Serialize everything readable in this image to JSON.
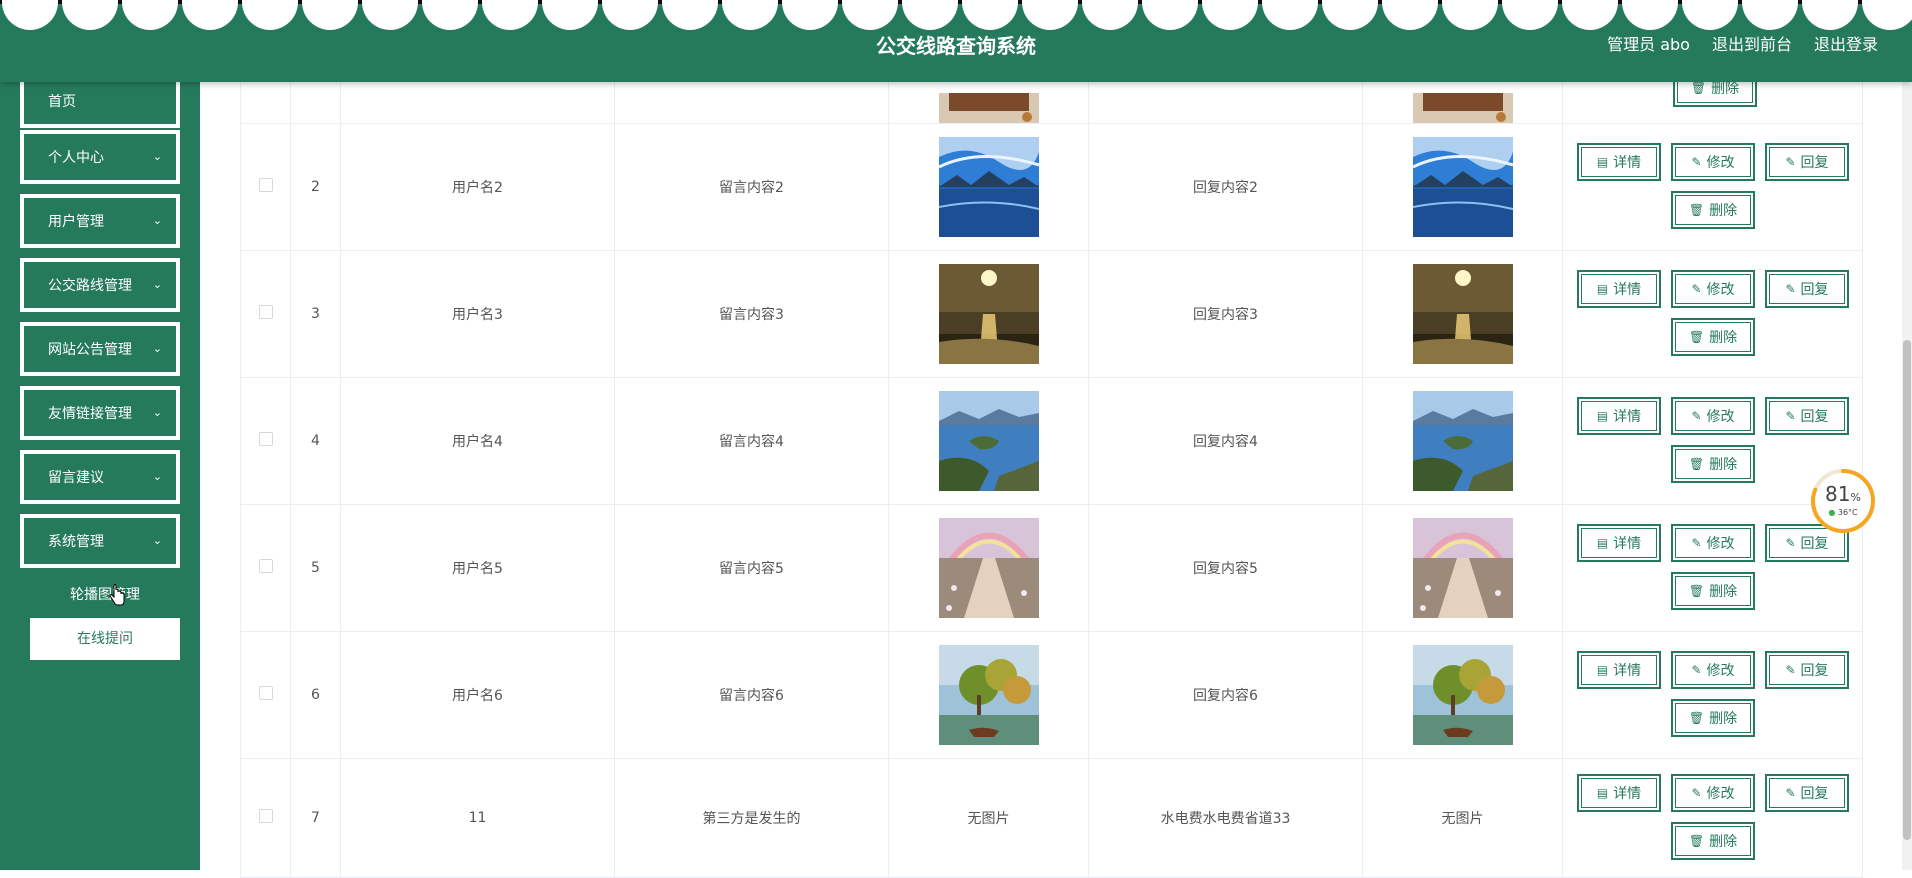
{
  "header": {
    "title": "公交线路查询系统",
    "user_label": "管理员 abo",
    "back_label": "退出到前台",
    "logout_label": "退出登录"
  },
  "sidebar": {
    "items": [
      {
        "label": "首页",
        "has_arrow": false
      },
      {
        "label": "个人中心",
        "has_arrow": true
      },
      {
        "label": "用户管理",
        "has_arrow": true
      },
      {
        "label": "公交路线管理",
        "has_arrow": true
      },
      {
        "label": "网站公告管理",
        "has_arrow": true
      },
      {
        "label": "友情链接管理",
        "has_arrow": true
      },
      {
        "label": "留言建议",
        "has_arrow": true
      },
      {
        "label": "系统管理",
        "has_arrow": true
      }
    ],
    "submenu": [
      {
        "label": "轮播图管理",
        "active": true
      },
      {
        "label": "在线提问",
        "active": false
      }
    ]
  },
  "table": {
    "rows": [
      {
        "index": "2",
        "username": "用户名2",
        "content": "留言内容2",
        "image": "lake-clouds",
        "reply": "回复内容2",
        "reply_image": "lake-clouds"
      },
      {
        "index": "3",
        "username": "用户名3",
        "content": "留言内容3",
        "image": "sunset-sea",
        "reply": "回复内容3",
        "reply_image": "sunset-sea"
      },
      {
        "index": "4",
        "username": "用户名4",
        "content": "留言内容4",
        "image": "lake-peninsula",
        "reply": "回复内容4",
        "reply_image": "lake-peninsula"
      },
      {
        "index": "5",
        "username": "用户名5",
        "content": "留言内容5",
        "image": "rainbow-path",
        "reply": "回复内容5",
        "reply_image": "rainbow-path"
      },
      {
        "index": "6",
        "username": "用户名6",
        "content": "留言内容6",
        "image": "painted-trees",
        "reply": "回复内容6",
        "reply_image": "painted-trees"
      },
      {
        "index": "7",
        "username": "11",
        "content": "第三方是发生的",
        "image": "",
        "image_text": "无图片",
        "reply": "水电费水电费省道33",
        "reply_image": "",
        "reply_image_text": "无图片"
      }
    ],
    "buttons": {
      "detail": "详情",
      "edit": "修改",
      "reply": "回复",
      "delete": "删除"
    }
  },
  "gauge": {
    "percent": "81",
    "percent_unit": "%",
    "temp": "36°C",
    "fraction": 0.81
  },
  "colors": {
    "primary": "#267a5c",
    "gauge_ring": "#f5a623"
  }
}
